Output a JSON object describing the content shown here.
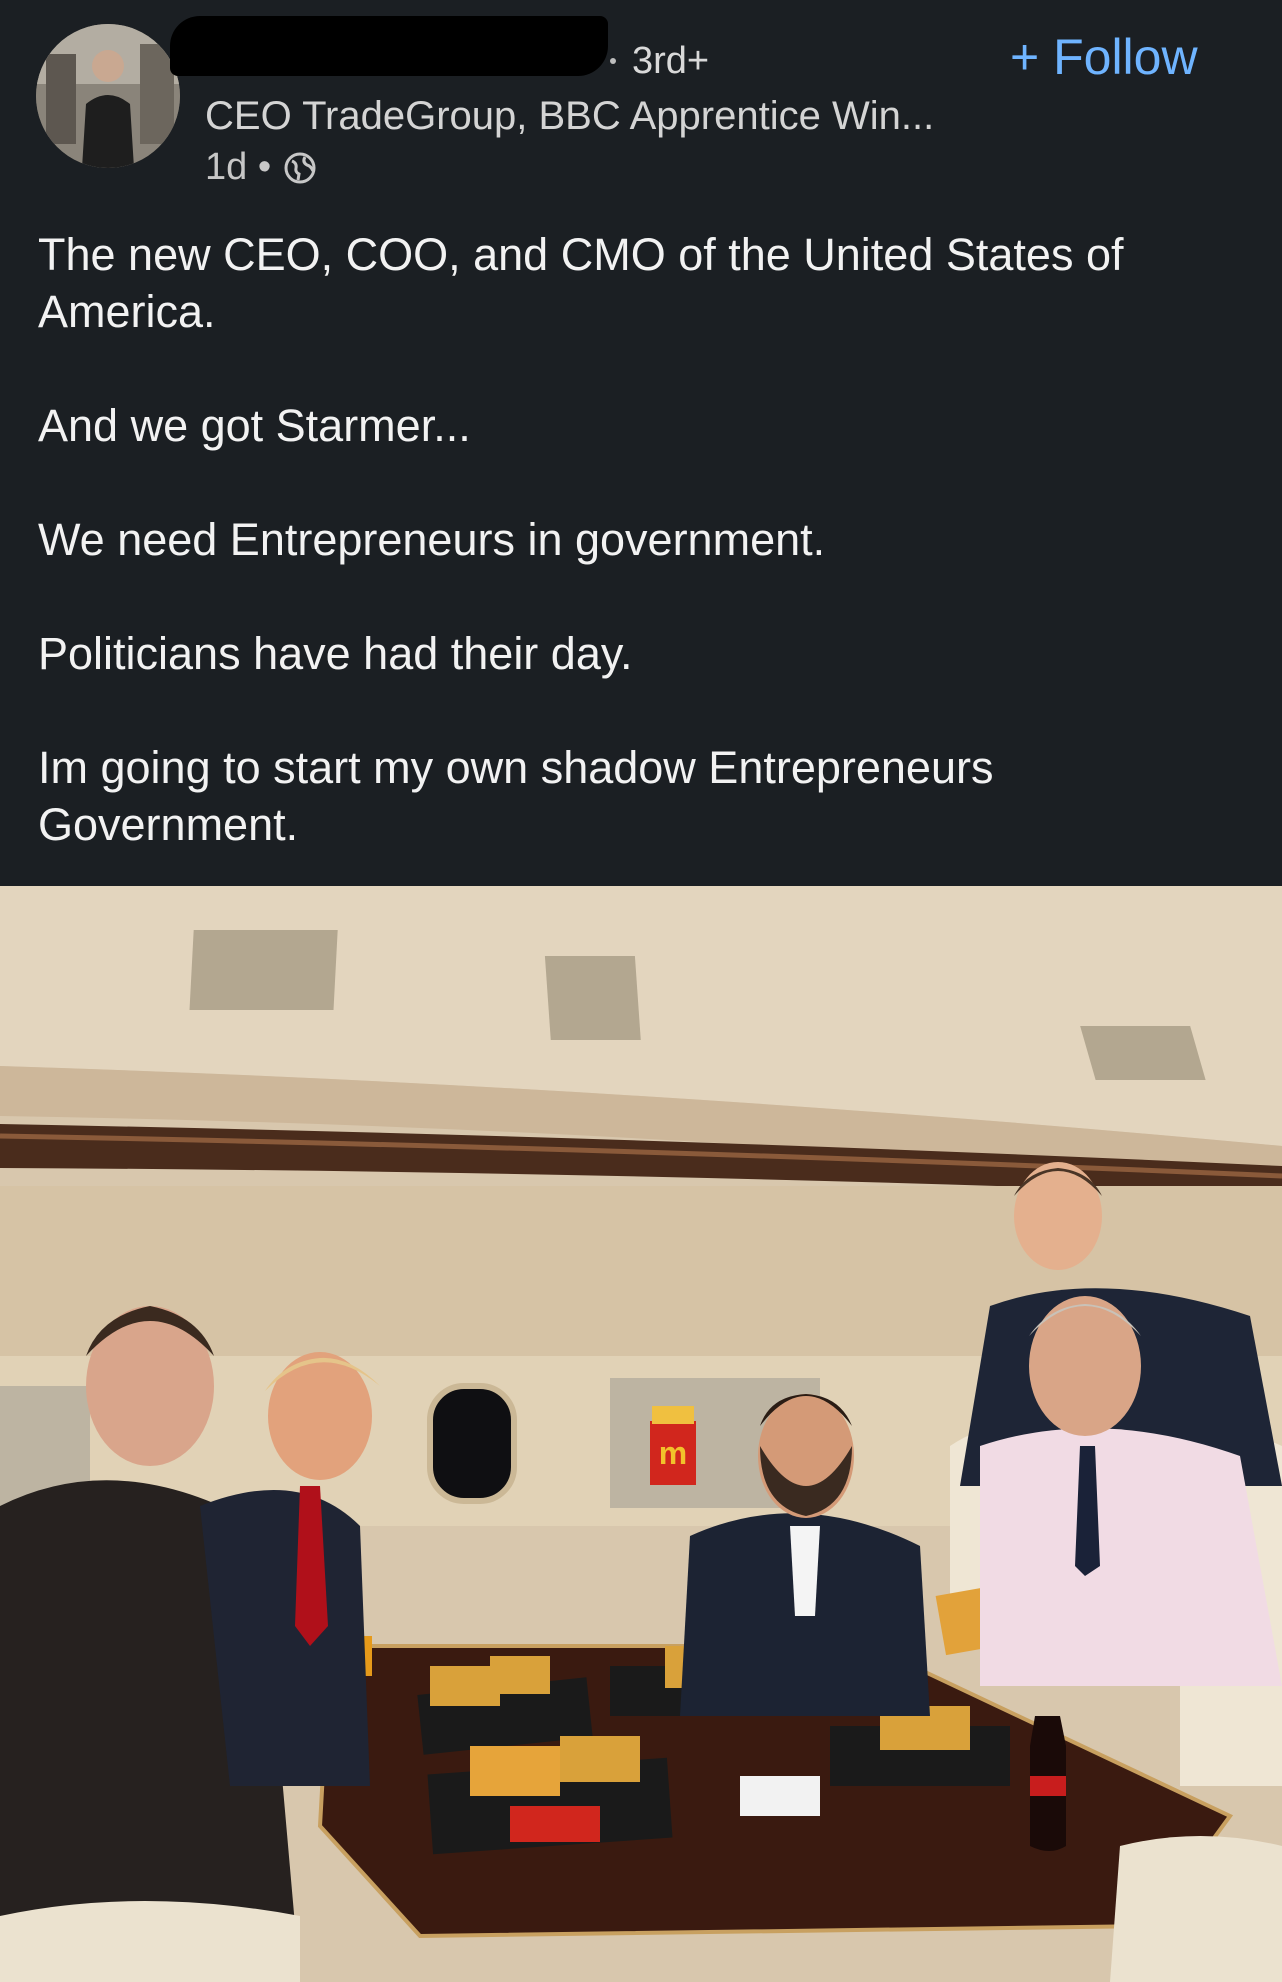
{
  "author": {
    "degree": "3rd+",
    "headline": "CEO TradeGroup, BBC Apprentice Win...",
    "time": "1d •",
    "follow_label": "+ Follow"
  },
  "post": {
    "paragraphs": [
      "The new CEO, COO, and CMO of the United States of America.",
      "And we got Starmer...",
      "We need Entrepreneurs in government.",
      "Politicians have had their day.",
      "Im going to start my own shadow Entrepreneurs Government."
    ]
  },
  "photo": {
    "fry_box_letter": "m"
  },
  "icons": {
    "visibility": "globe-icon"
  },
  "colors": {
    "background": "#1b1f23",
    "link": "#6fb4ff"
  }
}
